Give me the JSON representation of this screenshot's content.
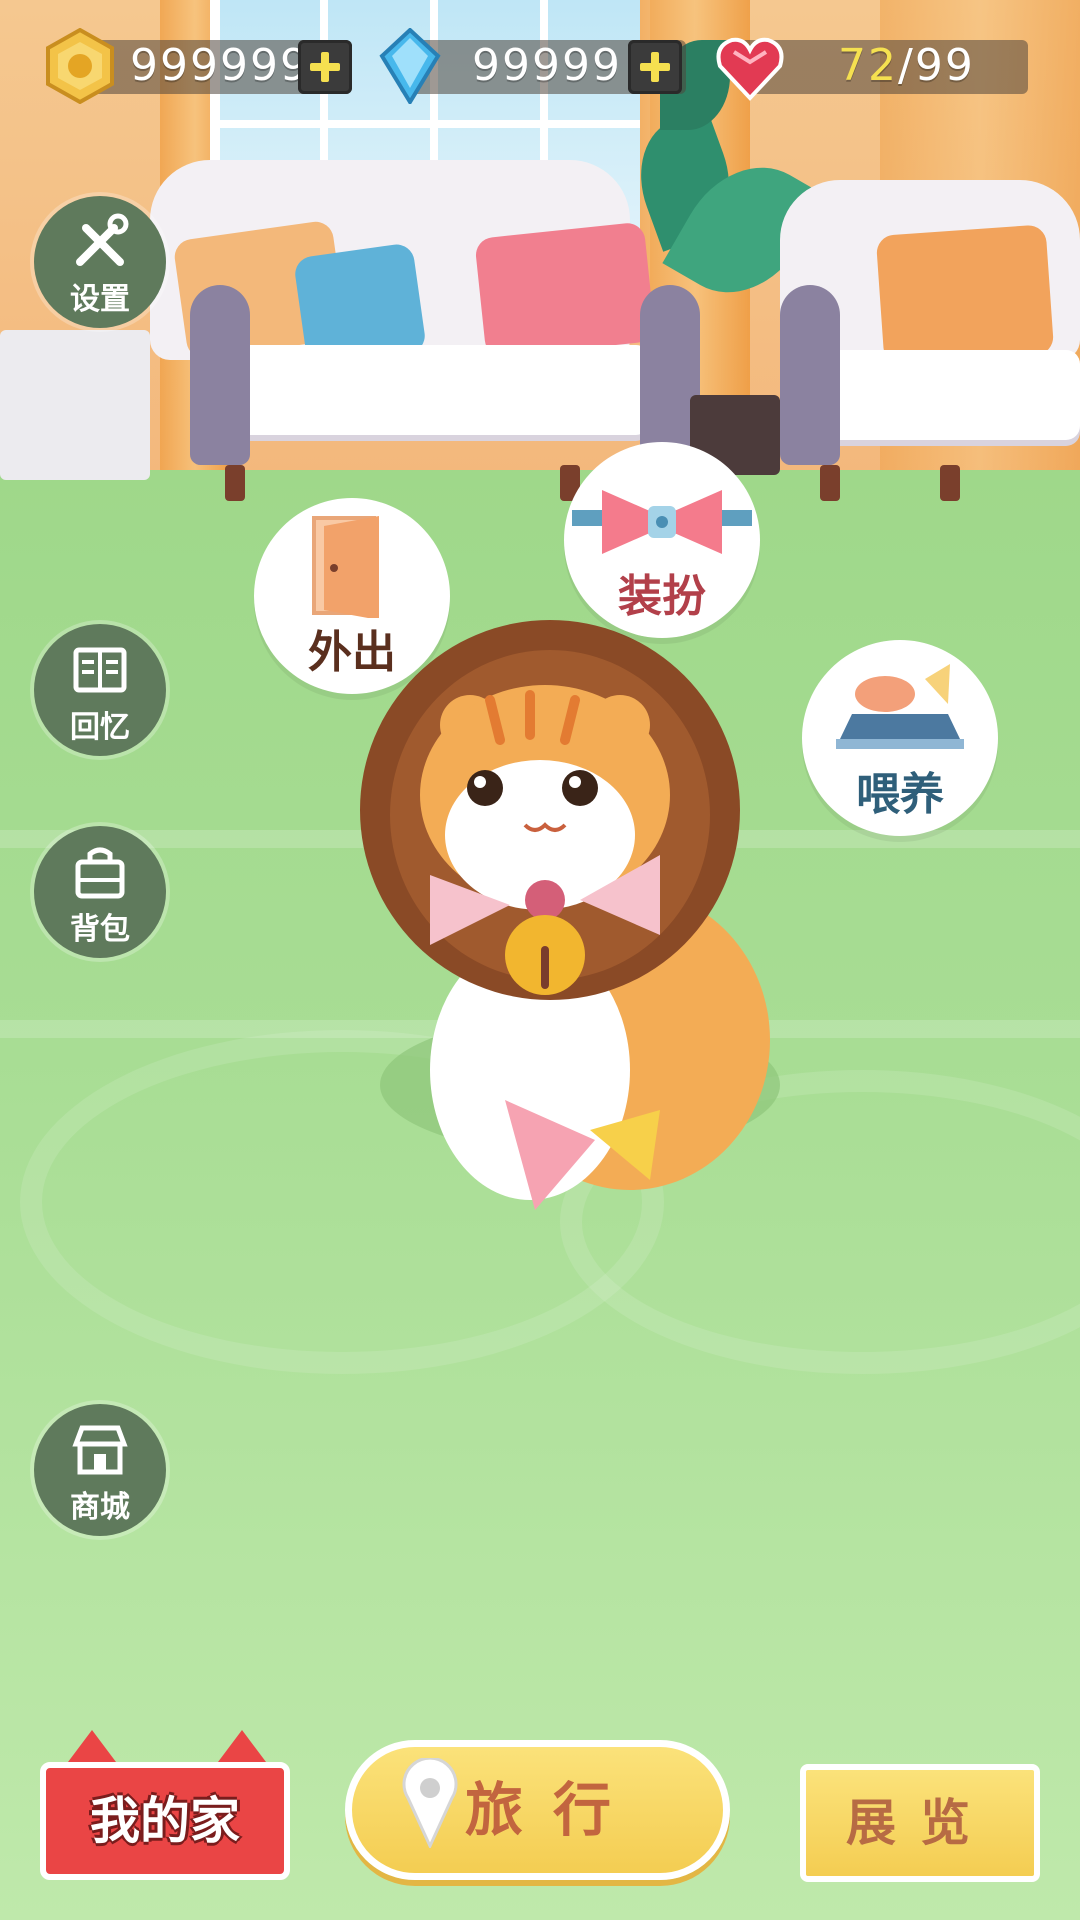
{
  "resources": {
    "coins": {
      "value": "999999",
      "icon": "coin-icon"
    },
    "gems": {
      "value": "99999",
      "icon": "gem-icon"
    },
    "hearts": {
      "current": "72",
      "separator": "/",
      "max": "99",
      "icon": "heart-icon"
    }
  },
  "side_menu": {
    "settings": {
      "label": "设置",
      "icon": "wrench-screwdriver-icon"
    },
    "memories": {
      "label": "回忆",
      "icon": "book-icon"
    },
    "backpack": {
      "label": "背包",
      "icon": "bag-icon"
    },
    "shop": {
      "label": "商城",
      "icon": "shop-icon"
    }
  },
  "actions": {
    "go_out": {
      "label": "外出",
      "icon": "door-icon"
    },
    "dress_up": {
      "label": "装扮",
      "icon": "bow-icon"
    },
    "feed": {
      "label": "喂养",
      "icon": "fish-bowl-icon"
    }
  },
  "bottom_nav": {
    "home": {
      "label": "我的家"
    },
    "travel": {
      "label": "旅行",
      "icon": "map-pin-icon"
    },
    "exhibition": {
      "label": "展览"
    }
  },
  "colors": {
    "home_red": "#ea4545",
    "travel_yellow": "#f4cd52",
    "side_button": "#5f7a5c",
    "heart_current": "#f5e050",
    "go_out_text": "#5a2f1e",
    "dress_text": "#b2404a",
    "feed_text": "#2f5f7a"
  }
}
